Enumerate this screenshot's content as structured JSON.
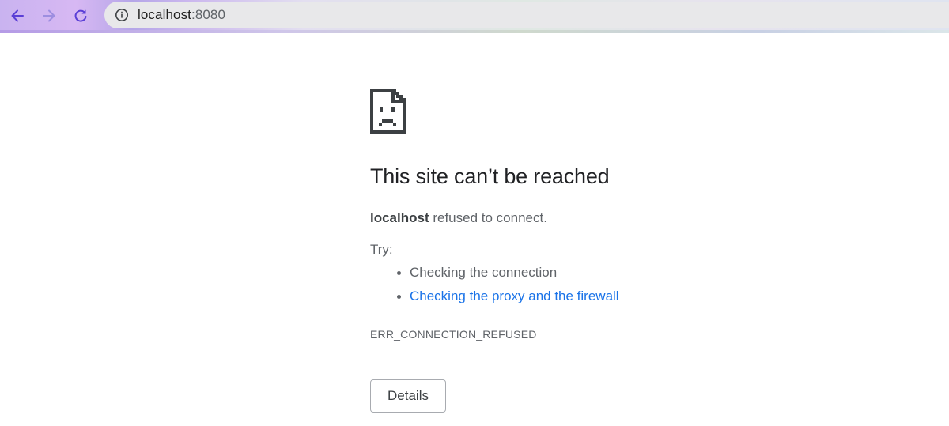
{
  "browser": {
    "url_host": "localhost",
    "url_port": ":8080",
    "icons": {
      "back": "arrow-left-icon",
      "forward": "arrow-right-icon",
      "reload": "reload-icon",
      "site_info": "info-icon"
    },
    "accent_color": "#5b3fd6"
  },
  "error_page": {
    "icon": "sad-document-icon",
    "title": "This site can’t be reached",
    "host": "localhost",
    "message_suffix": " refused to connect.",
    "try_label": "Try:",
    "suggestions": [
      {
        "text": "Checking the connection",
        "is_link": false
      },
      {
        "text": "Checking the proxy and the firewall",
        "is_link": true
      }
    ],
    "error_code": "ERR_CONNECTION_REFUSED",
    "details_label": "Details",
    "link_color": "#1a73e8"
  }
}
